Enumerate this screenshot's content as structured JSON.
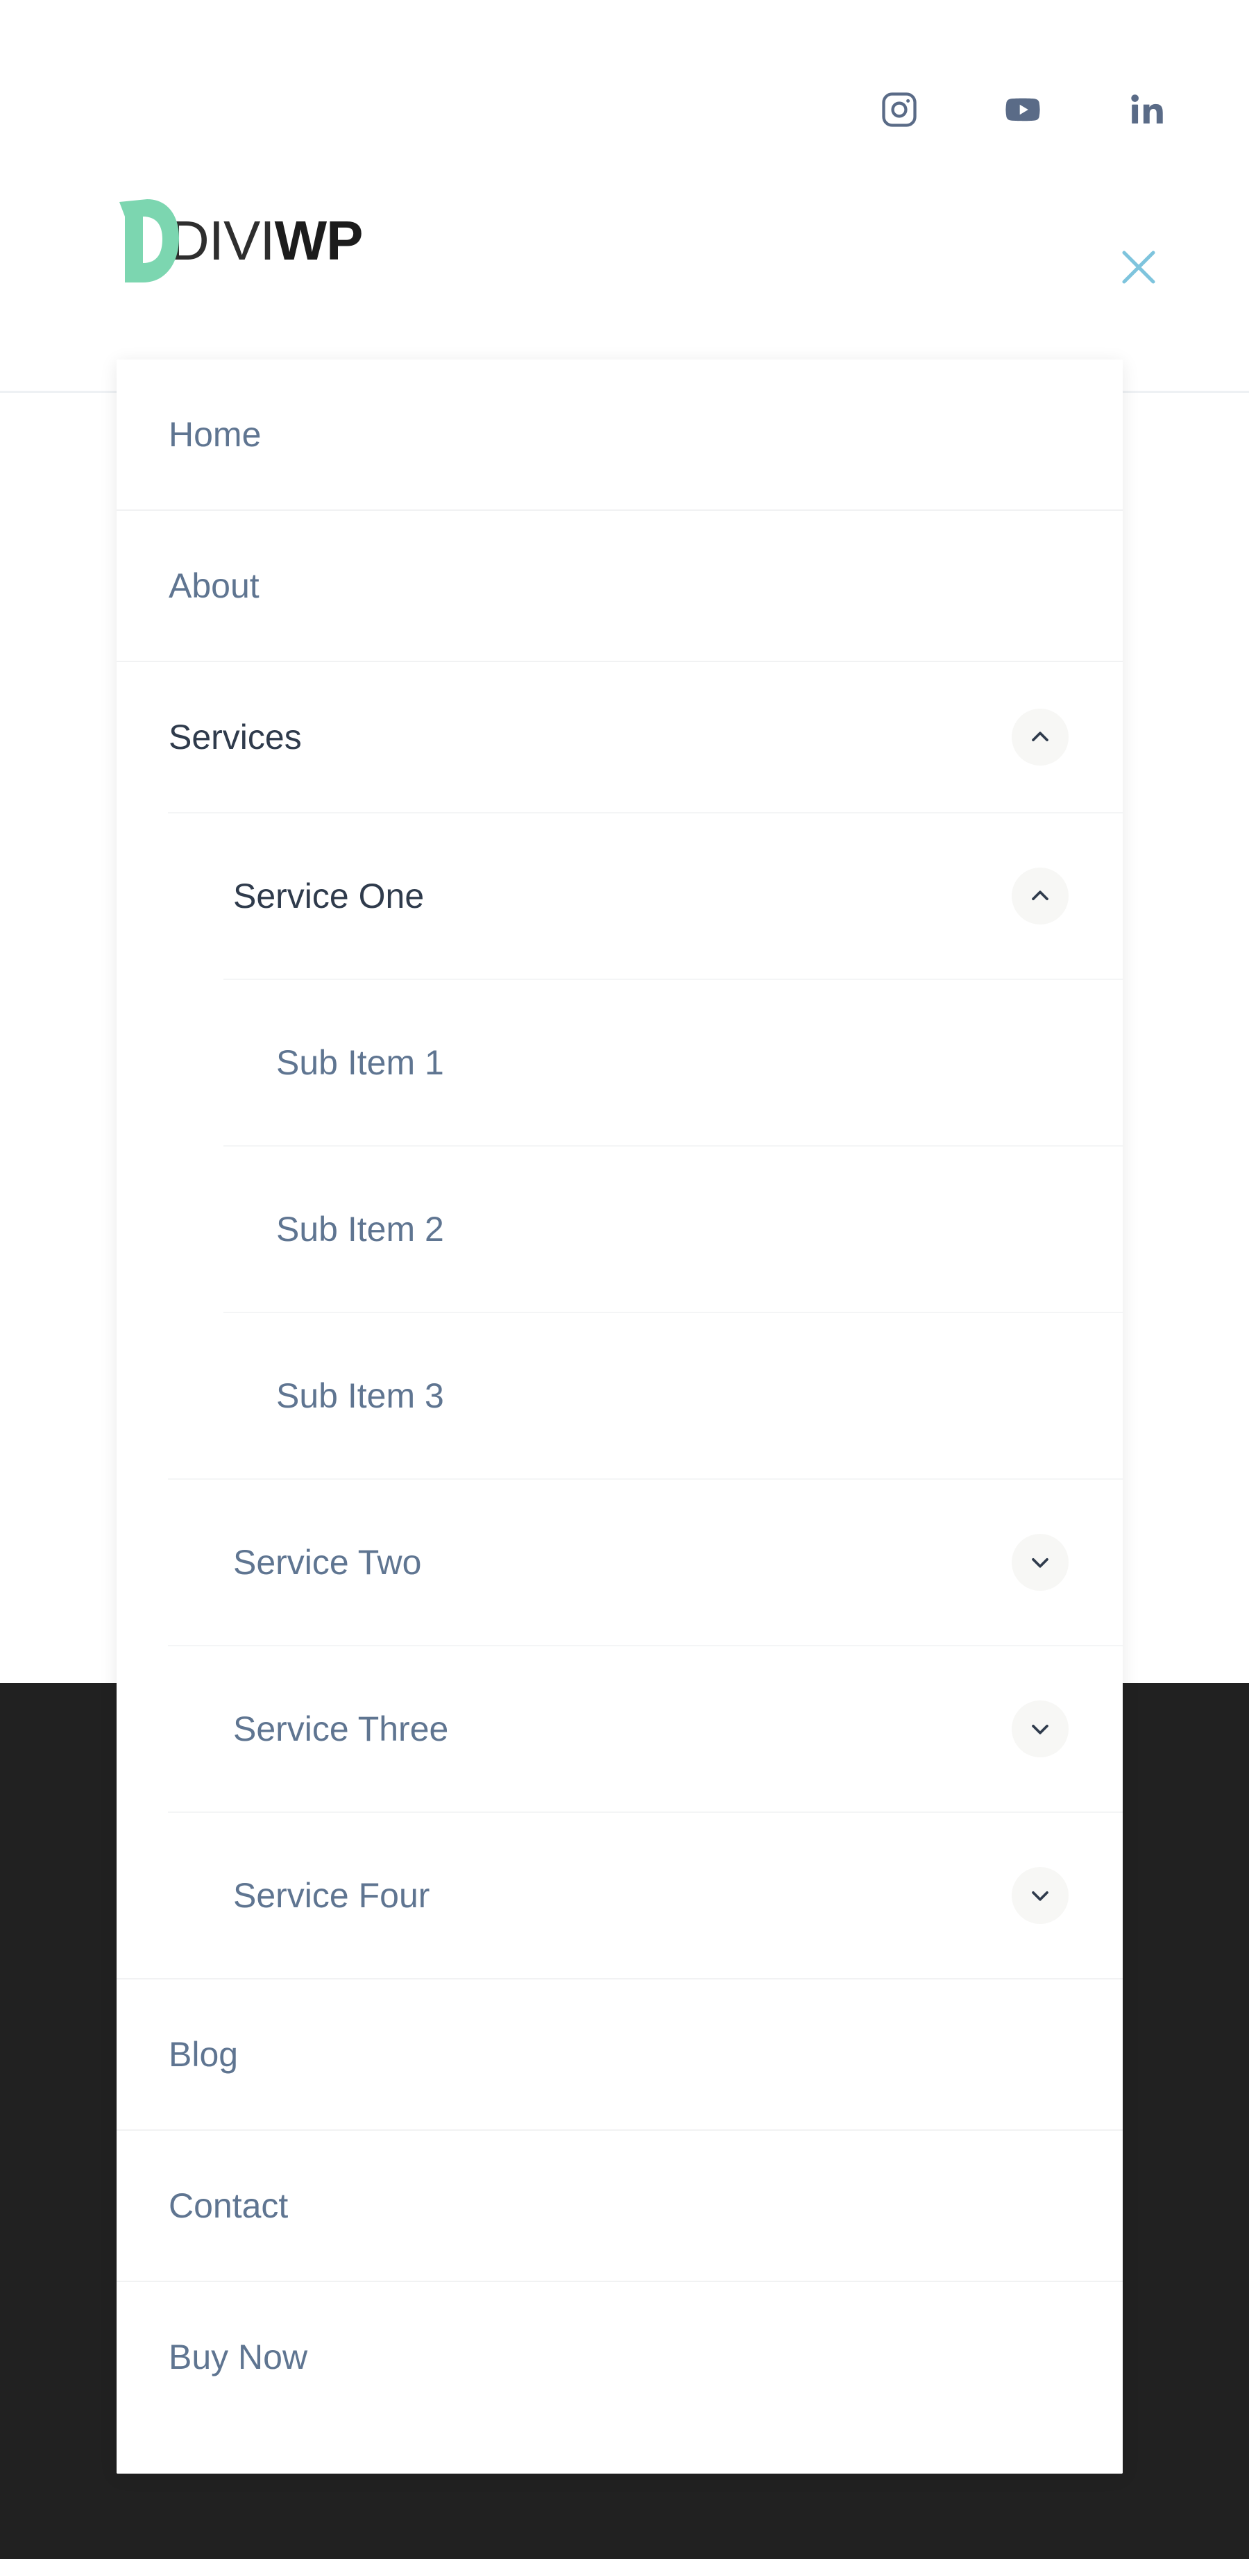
{
  "colors": {
    "brand_green": "#7cd6b0",
    "logo_dark": "#2e2e2e",
    "social_icon": "#5a6b87",
    "close_icon": "#7ec4dd",
    "menu_link": "#5f7591",
    "menu_link_active": "#2f3b4c",
    "divider": "#f1f2f3",
    "toggle_bg": "#f7f7f5",
    "toggle_chevron": "#2f3b4c",
    "dark_section": "#212121",
    "page_bg": "#ffffff"
  },
  "topbar": {
    "social": [
      {
        "name": "instagram-icon",
        "label": "Instagram"
      },
      {
        "name": "youtube-icon",
        "label": "YouTube"
      },
      {
        "name": "linkedin-icon",
        "label": "LinkedIn"
      }
    ]
  },
  "header": {
    "logo": {
      "mark": "diviwp-d-logo-icon",
      "text_light": "DIVI",
      "text_bold": "WP",
      "full_text": "DIVIWP"
    },
    "close_label": "Close menu"
  },
  "menu": {
    "items": [
      {
        "label": "Home",
        "level": 0,
        "name": "menu-item-home",
        "toggle": null,
        "active": false
      },
      {
        "label": "About",
        "level": 0,
        "name": "menu-item-about",
        "toggle": null,
        "active": false
      },
      {
        "label": "Services",
        "level": 0,
        "name": "menu-item-services",
        "toggle": "up",
        "active": true
      },
      {
        "label": "Service One",
        "level": 1,
        "name": "menu-item-service-one",
        "toggle": "up",
        "active": true
      },
      {
        "label": "Sub Item 1",
        "level": 2,
        "name": "menu-item-sub-item-1",
        "toggle": null,
        "active": false
      },
      {
        "label": "Sub Item 2",
        "level": 2,
        "name": "menu-item-sub-item-2",
        "toggle": null,
        "active": false
      },
      {
        "label": "Sub Item 3",
        "level": 2,
        "name": "menu-item-sub-item-3",
        "toggle": null,
        "active": false
      },
      {
        "label": "Service Two",
        "level": 1,
        "name": "menu-item-service-two",
        "toggle": "down",
        "active": false
      },
      {
        "label": "Service Three",
        "level": 1,
        "name": "menu-item-service-three",
        "toggle": "down",
        "active": false
      },
      {
        "label": "Service Four",
        "level": 1,
        "name": "menu-item-service-four",
        "toggle": "down",
        "active": false
      },
      {
        "label": "Blog",
        "level": 0,
        "name": "menu-item-blog",
        "toggle": null,
        "active": false
      },
      {
        "label": "Contact",
        "level": 0,
        "name": "menu-item-contact",
        "toggle": null,
        "active": false
      },
      {
        "label": "Buy Now",
        "level": 0,
        "name": "menu-item-buy-now",
        "toggle": null,
        "active": false
      }
    ]
  }
}
